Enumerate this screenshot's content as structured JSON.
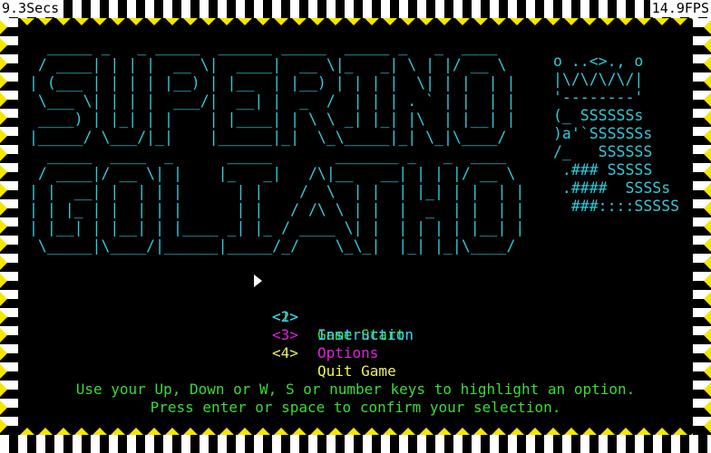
{
  "hud": {
    "elapsed": "9.3Secs",
    "fps": "14.9FPS"
  },
  "colors": {
    "background": "#000000",
    "border_yellow": "#f5e600",
    "border_white": "#ffffff",
    "title_cyan": "#33c9d9",
    "green": "#3adb3a",
    "cyan": "#33d9ff",
    "magenta": "#e020e0",
    "yellow": "#f0f060"
  },
  "title_art": [
    "  _____ _   _ _____  ______ _____  _____ _   _  ____",
    " / ____| | | |  __ \\|  ____|  __ \\|_   _| \\ | |/ __ \\",
    "| (___ | | | | |__) | |__  | |__) | | | |  \\| | |  | |",
    " \\___ \\| | | |  ___/|  __| |  _  /  | | | . ` | |  | |",
    " ____) | |_| | |    | |____| | \\ \\ _| |_| |\\  | |__| |",
    "|_____/ \\___/|_|    |______|_|  \\_\\_____|_| \\_|\\____/",
    "  _____  ____  _      _____       _______ _   _  ____",
    " / ____|/ __ \\| |    |_   _|   /\\|__   __| | | |/ __ \\",
    "| |  __| |  | | |      | |    /  \\  | |  | |_| | |  | |",
    "| | |_ | |  | | |      | |   / /\\ \\ | |  |  _  | |  | |",
    "| |__| | |__| | |____ _| |_ / ____ \\| |  | | | | |__| |",
    " \\_____|\\____/|______|_____/_/    \\_\\_|  |_| |_|\\____/"
  ],
  "dino_art": [
    "o ..<>., o",
    "|\\/\\/\\/\\/|",
    "'--------'",
    "(_ SSSSSSs",
    ")a'`SSSSSSs",
    "/_   SSSSSS",
    " .### SSSSS",
    " .####  SSSSs",
    "  ###::::SSSSS"
  ],
  "menu": {
    "items": [
      {
        "key": "<1>",
        "label": "Game Start",
        "color": "#3adb3a",
        "selected": true
      },
      {
        "key": "<2>",
        "label": "Instruction",
        "color": "#33d9ff",
        "selected": false
      },
      {
        "key": "<3>",
        "label": "Options",
        "color": "#e020e0",
        "selected": false
      },
      {
        "key": "<4>",
        "label": "Quit Game",
        "color": "#f0f060",
        "selected": false
      }
    ]
  },
  "help": {
    "line1": "Use your Up, Down or W, S or number keys to highlight an option.",
    "line2": "Press enter or space to confirm your selection."
  }
}
